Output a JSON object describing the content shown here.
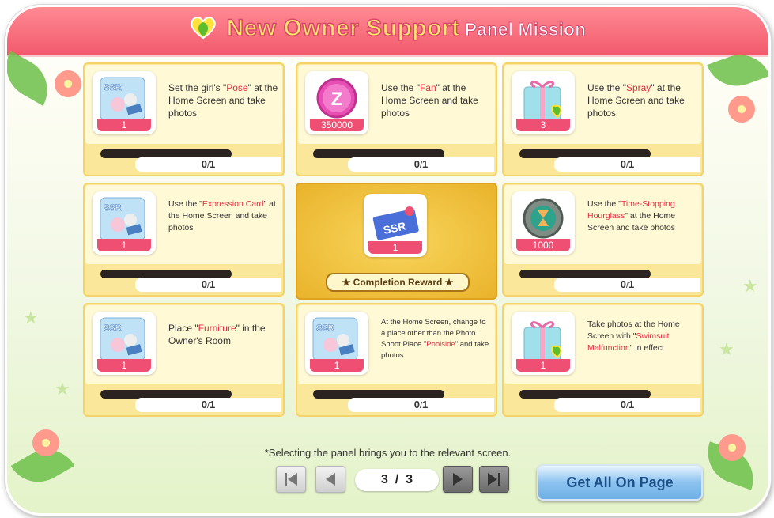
{
  "title": {
    "main": "New Owner Support",
    "sub": "Panel Mission"
  },
  "panels": [
    {
      "item": "ssr-photo-icon",
      "qty": "1",
      "desc_pre": "Set the girl's \"",
      "desc_hl": "Pose",
      "desc_post": "\" at the Home Screen and take photos",
      "progress": "0",
      "sep": "/",
      "total": "1"
    },
    {
      "item": "zack-coin-icon",
      "qty": "350000",
      "desc_pre": "Use the \"",
      "desc_hl": "Fan",
      "desc_post": "\" at the Home Screen and take photos",
      "progress": "0",
      "sep": "/",
      "total": "1"
    },
    {
      "item": "gift-box-icon",
      "qty": "3",
      "desc_pre": "Use the \"",
      "desc_hl": "Spray",
      "desc_post": "\" at the Home Screen and take photos",
      "progress": "0",
      "sep": "/",
      "total": "1"
    },
    {
      "item": "ssr-photo-icon",
      "qty": "1",
      "desc_pre": "Use the \"",
      "desc_hl": "Expression Card",
      "desc_post": "\" at the Home Screen and take photos",
      "progress": "0",
      "sep": "/",
      "total": "1"
    },
    {
      "item": "hourglass-icon",
      "qty": "1000",
      "desc_pre": "Use the \"",
      "desc_hl": "Time-Stopping Hourglass",
      "desc_post": "\" at the Home Screen and take photos",
      "progress": "0",
      "sep": "/",
      "total": "1"
    },
    {
      "item": "ssr-photo-icon",
      "qty": "1",
      "desc_pre": "Place \"",
      "desc_hl": "Furniture",
      "desc_post": "\" in the Owner's Room",
      "progress": "0",
      "sep": "/",
      "total": "1"
    },
    {
      "item": "ssr-photo-icon",
      "qty": "1",
      "desc_pre": "At the Home Screen, change to a place other than the Photo Shoot Place \"",
      "desc_hl": "Poolside",
      "desc_post": "\" and take photos",
      "progress": "0",
      "sep": "/",
      "total": "1"
    },
    {
      "item": "gift-box-icon",
      "qty": "1",
      "desc_pre": "Take photos at the Home Screen with \"",
      "desc_hl": "Swimsuit Malfunction",
      "desc_post": "\" in effect",
      "progress": "0",
      "sep": "/",
      "total": "1"
    }
  ],
  "completion": {
    "item": "ssr-ticket-icon",
    "qty": "1",
    "label": "★ Completion Reward ★"
  },
  "note": "*Selecting the panel brings you to the relevant screen.",
  "pagination": {
    "current": "3",
    "sep": "/",
    "total": "3"
  },
  "get_all_label": "Get All On Page",
  "colors": {
    "title_bar": "#f25a6c",
    "highlight": "#e32c44",
    "panel_bg": "#fbe79a",
    "button_blue": "#8cc3f0"
  }
}
